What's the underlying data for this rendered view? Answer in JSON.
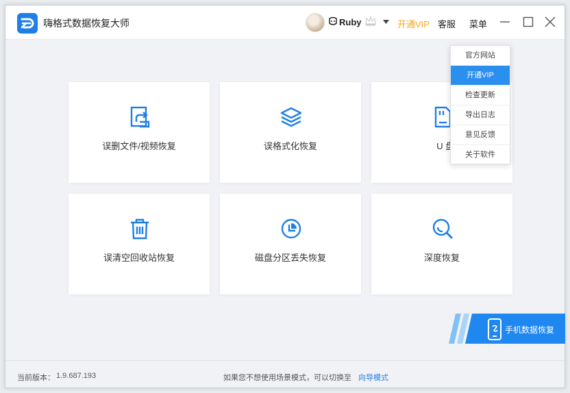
{
  "app": {
    "title": "嗨格式数据恢复大师"
  },
  "header": {
    "user_name": "Ruby",
    "vip_label": "开通VIP",
    "service_label": "客服",
    "menu_label": "菜单"
  },
  "cards": [
    {
      "label": "误删文件/视频恢复",
      "icon": "file-restore-icon"
    },
    {
      "label": "误格式化恢复",
      "icon": "layers-icon"
    },
    {
      "label": "U 盘/内存卡恢复",
      "label_visible": "U 盘/内存",
      "icon": "sd-card-icon"
    },
    {
      "label": "误清空回收站恢复",
      "icon": "trash-icon"
    },
    {
      "label": "磁盘分区丢失恢复",
      "icon": "pie-chart-icon"
    },
    {
      "label": "深度恢复",
      "icon": "deep-search-icon"
    }
  ],
  "menu": {
    "items": [
      {
        "label": "官方网站"
      },
      {
        "label": "开通VIP"
      },
      {
        "label": "检查更新"
      },
      {
        "label": "导出日志"
      },
      {
        "label": "意见反馈"
      },
      {
        "label": "关于软件"
      }
    ],
    "active_index": 1
  },
  "mobile_banner": {
    "label": "手机数据恢复"
  },
  "footer": {
    "version_label": "当前版本：",
    "version_value": "1.9.687.193",
    "switch_text": "如果您不想使用场景模式，可以切换至",
    "guide_link": "向导模式"
  },
  "colors": {
    "accent": "#1e7fe6",
    "vip": "#f5a623",
    "menu_active": "#2b8ff0"
  }
}
